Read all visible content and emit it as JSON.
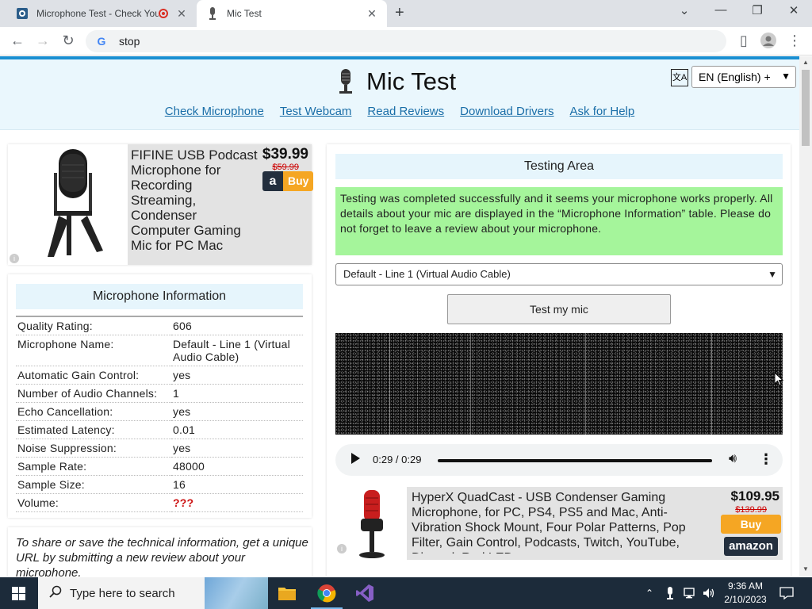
{
  "browser": {
    "tabs": [
      {
        "title": "Microphone Test - Check Your",
        "active": false
      },
      {
        "title": "Mic Test",
        "active": true
      }
    ],
    "address": "stop"
  },
  "header": {
    "title": "Mic Test",
    "nav": [
      "Check Microphone",
      "Test Webcam",
      "Read Reviews",
      "Download Drivers",
      "Ask for Help"
    ],
    "language": "EN (English) +"
  },
  "ad_left": {
    "title": "FIFINE USB Podcast Microphone for Recording Streaming, Condenser Computer Gaming Mic for PC Mac",
    "price": "$39.99",
    "old_price": "$59.99",
    "buy_label": "Buy",
    "info": "i"
  },
  "mic_info": {
    "heading": "Microphone Information",
    "rows": [
      {
        "key": "Quality Rating:",
        "value": "606"
      },
      {
        "key": "Microphone Name:",
        "value": "Default - Line 1 (Virtual Audio Cable)"
      },
      {
        "key": "Automatic Gain Control:",
        "value": "yes"
      },
      {
        "key": "Number of Audio Channels:",
        "value": "1"
      },
      {
        "key": "Echo Cancellation:",
        "value": "yes"
      },
      {
        "key": "Estimated Latency:",
        "value": "0.01"
      },
      {
        "key": "Noise Suppression:",
        "value": "yes"
      },
      {
        "key": "Sample Rate:",
        "value": "48000"
      },
      {
        "key": "Sample Size:",
        "value": "16"
      },
      {
        "key": "Volume:",
        "value": "???"
      }
    ]
  },
  "share": {
    "text": "To share or save the technical information, get a unique URL by submitting a new review about your microphone."
  },
  "testing": {
    "heading": "Testing Area",
    "result": "Testing was completed successfully and it seems your microphone works properly. All details about your mic are displayed in the “Microphone Information” table. Please do not forget to leave a review about your microphone.",
    "device": "Default - Line 1 (Virtual Audio Cable)",
    "test_button": "Test my mic",
    "audio_time": "0:29 / 0:29",
    "audio_progress": 1.0
  },
  "ad_right": {
    "title": "HyperX QuadCast - USB Condenser Gaming Microphone, for PC, PS4, PS5 and Mac, Anti-Vibration Shock Mount, Four Polar Patterns, Pop Filter, Gain Control, Podcasts, Twitch, YouTube, Discord, Red LED",
    "price": "$109.95",
    "old_price": "$139.99",
    "buy_label": "Buy",
    "brand": "amazon",
    "info": "i"
  },
  "taskbar": {
    "search_placeholder": "Type here to search",
    "time": "9:36 AM",
    "date": "2/10/2023"
  },
  "colors": {
    "accent": "#1a8fd1",
    "header_bg": "#eaf7fd",
    "success_bg": "#a5f59b",
    "link": "#1a6ea8",
    "warning": "#cc1111",
    "amazon_orange": "#f5a623",
    "taskbar": "#1c2b3a"
  },
  "icons": [
    "microphone-icon",
    "translate-icon",
    "play-icon",
    "volume-icon",
    "more-icon",
    "search-icon",
    "windows-icon",
    "chrome-icon",
    "folder-icon",
    "visual-studio-icon",
    "mic-tray-icon",
    "network-icon",
    "speaker-icon",
    "notification-icon"
  ]
}
